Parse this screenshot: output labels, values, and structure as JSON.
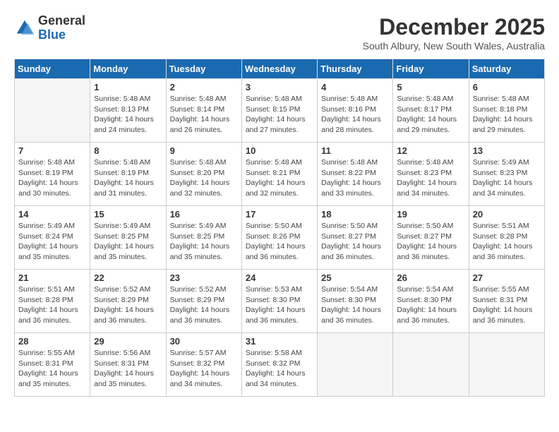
{
  "logo": {
    "line1": "General",
    "line2": "Blue"
  },
  "title": "December 2025",
  "location": "South Albury, New South Wales, Australia",
  "days_of_week": [
    "Sunday",
    "Monday",
    "Tuesday",
    "Wednesday",
    "Thursday",
    "Friday",
    "Saturday"
  ],
  "weeks": [
    [
      {
        "day": "",
        "info": ""
      },
      {
        "day": "1",
        "info": "Sunrise: 5:48 AM\nSunset: 8:13 PM\nDaylight: 14 hours\nand 24 minutes."
      },
      {
        "day": "2",
        "info": "Sunrise: 5:48 AM\nSunset: 8:14 PM\nDaylight: 14 hours\nand 26 minutes."
      },
      {
        "day": "3",
        "info": "Sunrise: 5:48 AM\nSunset: 8:15 PM\nDaylight: 14 hours\nand 27 minutes."
      },
      {
        "day": "4",
        "info": "Sunrise: 5:48 AM\nSunset: 8:16 PM\nDaylight: 14 hours\nand 28 minutes."
      },
      {
        "day": "5",
        "info": "Sunrise: 5:48 AM\nSunset: 8:17 PM\nDaylight: 14 hours\nand 29 minutes."
      },
      {
        "day": "6",
        "info": "Sunrise: 5:48 AM\nSunset: 8:18 PM\nDaylight: 14 hours\nand 29 minutes."
      }
    ],
    [
      {
        "day": "7",
        "info": "Sunrise: 5:48 AM\nSunset: 8:19 PM\nDaylight: 14 hours\nand 30 minutes."
      },
      {
        "day": "8",
        "info": "Sunrise: 5:48 AM\nSunset: 8:19 PM\nDaylight: 14 hours\nand 31 minutes."
      },
      {
        "day": "9",
        "info": "Sunrise: 5:48 AM\nSunset: 8:20 PM\nDaylight: 14 hours\nand 32 minutes."
      },
      {
        "day": "10",
        "info": "Sunrise: 5:48 AM\nSunset: 8:21 PM\nDaylight: 14 hours\nand 32 minutes."
      },
      {
        "day": "11",
        "info": "Sunrise: 5:48 AM\nSunset: 8:22 PM\nDaylight: 14 hours\nand 33 minutes."
      },
      {
        "day": "12",
        "info": "Sunrise: 5:48 AM\nSunset: 8:23 PM\nDaylight: 14 hours\nand 34 minutes."
      },
      {
        "day": "13",
        "info": "Sunrise: 5:49 AM\nSunset: 8:23 PM\nDaylight: 14 hours\nand 34 minutes."
      }
    ],
    [
      {
        "day": "14",
        "info": "Sunrise: 5:49 AM\nSunset: 8:24 PM\nDaylight: 14 hours\nand 35 minutes."
      },
      {
        "day": "15",
        "info": "Sunrise: 5:49 AM\nSunset: 8:25 PM\nDaylight: 14 hours\nand 35 minutes."
      },
      {
        "day": "16",
        "info": "Sunrise: 5:49 AM\nSunset: 8:25 PM\nDaylight: 14 hours\nand 35 minutes."
      },
      {
        "day": "17",
        "info": "Sunrise: 5:50 AM\nSunset: 8:26 PM\nDaylight: 14 hours\nand 36 minutes."
      },
      {
        "day": "18",
        "info": "Sunrise: 5:50 AM\nSunset: 8:27 PM\nDaylight: 14 hours\nand 36 minutes."
      },
      {
        "day": "19",
        "info": "Sunrise: 5:50 AM\nSunset: 8:27 PM\nDaylight: 14 hours\nand 36 minutes."
      },
      {
        "day": "20",
        "info": "Sunrise: 5:51 AM\nSunset: 8:28 PM\nDaylight: 14 hours\nand 36 minutes."
      }
    ],
    [
      {
        "day": "21",
        "info": "Sunrise: 5:51 AM\nSunset: 8:28 PM\nDaylight: 14 hours\nand 36 minutes."
      },
      {
        "day": "22",
        "info": "Sunrise: 5:52 AM\nSunset: 8:29 PM\nDaylight: 14 hours\nand 36 minutes."
      },
      {
        "day": "23",
        "info": "Sunrise: 5:52 AM\nSunset: 8:29 PM\nDaylight: 14 hours\nand 36 minutes."
      },
      {
        "day": "24",
        "info": "Sunrise: 5:53 AM\nSunset: 8:30 PM\nDaylight: 14 hours\nand 36 minutes."
      },
      {
        "day": "25",
        "info": "Sunrise: 5:54 AM\nSunset: 8:30 PM\nDaylight: 14 hours\nand 36 minutes."
      },
      {
        "day": "26",
        "info": "Sunrise: 5:54 AM\nSunset: 8:30 PM\nDaylight: 14 hours\nand 36 minutes."
      },
      {
        "day": "27",
        "info": "Sunrise: 5:55 AM\nSunset: 8:31 PM\nDaylight: 14 hours\nand 36 minutes."
      }
    ],
    [
      {
        "day": "28",
        "info": "Sunrise: 5:55 AM\nSunset: 8:31 PM\nDaylight: 14 hours\nand 35 minutes."
      },
      {
        "day": "29",
        "info": "Sunrise: 5:56 AM\nSunset: 8:31 PM\nDaylight: 14 hours\nand 35 minutes."
      },
      {
        "day": "30",
        "info": "Sunrise: 5:57 AM\nSunset: 8:32 PM\nDaylight: 14 hours\nand 34 minutes."
      },
      {
        "day": "31",
        "info": "Sunrise: 5:58 AM\nSunset: 8:32 PM\nDaylight: 14 hours\nand 34 minutes."
      },
      {
        "day": "",
        "info": ""
      },
      {
        "day": "",
        "info": ""
      },
      {
        "day": "",
        "info": ""
      }
    ]
  ]
}
